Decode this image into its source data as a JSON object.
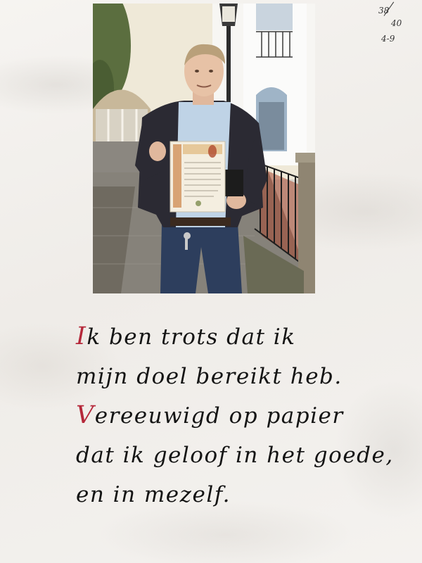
{
  "page_number": {
    "numerator": "38",
    "denominator": "40",
    "date": "4-9"
  },
  "photo": {
    "subject": "man-holding-certificate",
    "colors": {
      "sky": "#dfe7ee",
      "building": "#f2eee4",
      "pavement": "#7f7c74",
      "jacket": "#2b2a33",
      "shirt": "#bfd3e6",
      "jeans": "#2d3e5d",
      "certificate": "#f4eee0"
    }
  },
  "caption": {
    "accent_color": "#b5283a",
    "lines": [
      {
        "initial": "I",
        "rest": "k ben trots dat ik"
      },
      {
        "initial": "",
        "rest": "mijn doel bereikt heb."
      },
      {
        "initial": "V",
        "rest": "ereeuwigd op papier"
      },
      {
        "initial": "",
        "rest": "dat ik geloof in het goede,"
      },
      {
        "initial": "",
        "rest": "en in mezelf."
      }
    ]
  }
}
